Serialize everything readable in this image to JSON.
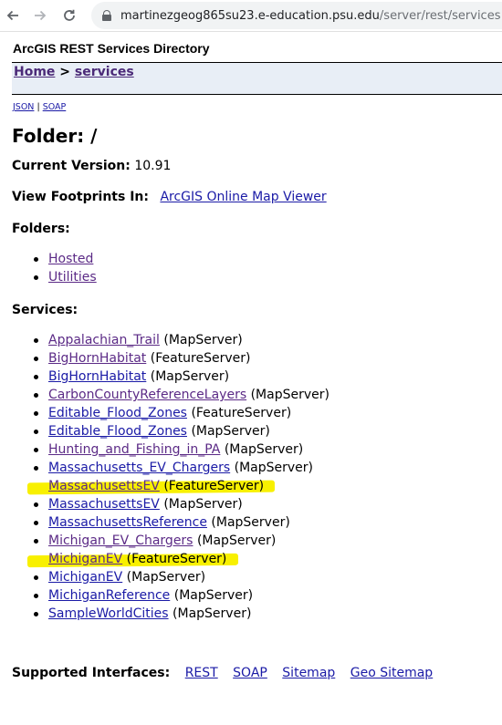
{
  "browser": {
    "url_host": "martinezgeog865su23.e-education.psu.edu",
    "url_path": "/server/rest/services"
  },
  "page": {
    "directory_title": "ArcGIS REST Services Directory",
    "breadcrumb": {
      "home": "Home",
      "separator": ">",
      "current": "services"
    },
    "formats": {
      "json": "JSON",
      "separator": "|",
      "soap": "SOAP"
    },
    "folder_title": "Folder: /",
    "version": {
      "label": "Current Version:",
      "value": "10.91"
    },
    "footprints": {
      "label": "View Footprints In:",
      "link": "ArcGIS Online Map Viewer"
    },
    "folders": {
      "heading": "Folders:",
      "items": [
        "Hosted",
        "Utilities"
      ]
    },
    "services": {
      "heading": "Services:",
      "items": [
        {
          "name": "Appalachian_Trail",
          "type": "(MapServer)",
          "visited": true,
          "highlighted": false
        },
        {
          "name": "BigHornHabitat",
          "type": "(FeatureServer)",
          "visited": true,
          "highlighted": false
        },
        {
          "name": "BigHornHabitat",
          "type": "(MapServer)",
          "visited": false,
          "highlighted": false
        },
        {
          "name": "CarbonCountyReferenceLayers",
          "type": "(MapServer)",
          "visited": true,
          "highlighted": false
        },
        {
          "name": "Editable_Flood_Zones",
          "type": "(FeatureServer)",
          "visited": false,
          "highlighted": false
        },
        {
          "name": "Editable_Flood_Zones",
          "type": "(MapServer)",
          "visited": false,
          "highlighted": false
        },
        {
          "name": "Hunting_and_Fishing_in_PA",
          "type": "(MapServer)",
          "visited": true,
          "highlighted": false
        },
        {
          "name": "Massachusetts_EV_Chargers",
          "type": "(MapServer)",
          "visited": false,
          "highlighted": false
        },
        {
          "name": "MassachusettsEV",
          "type": "(FeatureServer)",
          "visited": true,
          "highlighted": true
        },
        {
          "name": "MassachusettsEV",
          "type": "(MapServer)",
          "visited": false,
          "highlighted": false
        },
        {
          "name": "MassachusettsReference",
          "type": "(MapServer)",
          "visited": false,
          "highlighted": false
        },
        {
          "name": "Michigan_EV_Chargers",
          "type": "(MapServer)",
          "visited": true,
          "highlighted": false
        },
        {
          "name": "MichiganEV",
          "type": "(FeatureServer)",
          "visited": true,
          "highlighted": true
        },
        {
          "name": "MichiganEV",
          "type": "(MapServer)",
          "visited": false,
          "highlighted": false
        },
        {
          "name": "MichiganReference",
          "type": "(MapServer)",
          "visited": false,
          "highlighted": false
        },
        {
          "name": "SampleWorldCities",
          "type": "(MapServer)",
          "visited": false,
          "highlighted": false
        }
      ]
    },
    "interfaces": {
      "label": "Supported Interfaces:",
      "links": [
        "REST",
        "SOAP",
        "Sitemap",
        "Geo Sitemap"
      ]
    }
  },
  "colors": {
    "highlight": "#f8f000",
    "link_unvisited": "#1a1aa6",
    "link_visited": "#5b2a86",
    "breadcrumb_bg": "#e8eef6"
  },
  "icons": [
    "back-arrow-icon",
    "forward-arrow-icon",
    "reload-icon",
    "lock-icon"
  ]
}
